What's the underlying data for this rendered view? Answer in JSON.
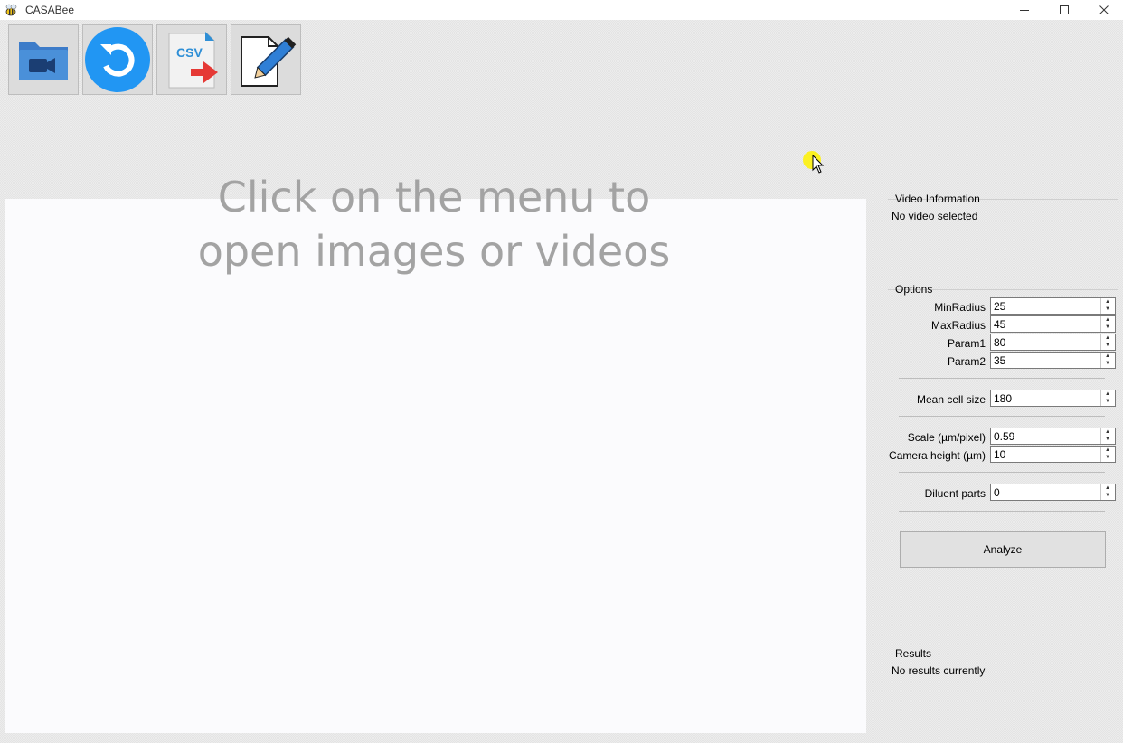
{
  "window": {
    "title": "CASABee",
    "app_icon": "bee-icon",
    "controls": [
      "minimize-icon",
      "maximize-icon",
      "close-icon"
    ]
  },
  "toolbar": {
    "buttons": [
      {
        "icon": "open-video-folder-icon"
      },
      {
        "icon": "reset-icon"
      },
      {
        "icon": "export-csv-icon",
        "text": "CSV"
      },
      {
        "icon": "edit-document-icon"
      }
    ]
  },
  "viewer": {
    "placeholder": "Click on the menu to\nopen images or videos"
  },
  "video_info": {
    "title": "Video Information",
    "text": "No video selected"
  },
  "options": {
    "title": "Options",
    "min_radius": {
      "label": "MinRadius",
      "value": "25"
    },
    "max_radius": {
      "label": "MaxRadius",
      "value": "45"
    },
    "param1": {
      "label": "Param1",
      "value": "80"
    },
    "param2": {
      "label": "Param2",
      "value": "35"
    },
    "mean_cell_size": {
      "label": "Mean cell size",
      "value": "180"
    },
    "scale": {
      "label": "Scale (µm/pixel)",
      "value": "0.59"
    },
    "camera_height": {
      "label": "Camera height (µm)",
      "value": "10"
    },
    "diluent_parts": {
      "label": "Diluent parts",
      "value": "0"
    },
    "analyze_label": "Analyze"
  },
  "results": {
    "title": "Results",
    "text": "No results currently"
  },
  "colors": {
    "accent_blue": "#2196f3",
    "folder_blue": "#4a90d9",
    "csv_red": "#e53935",
    "placeholder_gray": "#a3a3a3"
  }
}
